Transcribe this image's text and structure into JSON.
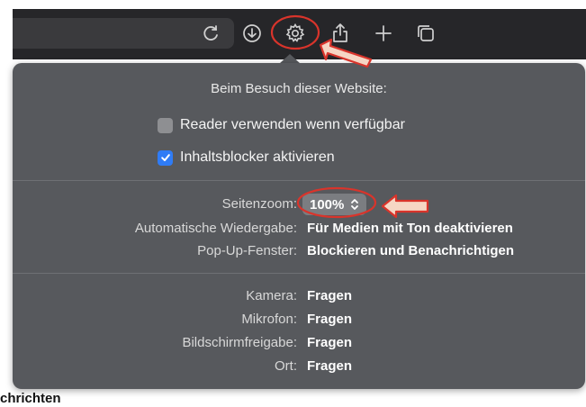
{
  "popover": {
    "title": "Beim Besuch dieser Website:",
    "checkboxes": [
      {
        "label": "Reader verwenden wenn verfügbar",
        "checked": false
      },
      {
        "label": "Inhaltsblocker aktivieren",
        "checked": true
      }
    ],
    "settings": [
      {
        "label": "Seitenzoom:",
        "value": "100%"
      },
      {
        "label": "Automatische Wiedergabe:",
        "value": "Für Medien mit Ton deaktivieren"
      },
      {
        "label": "Pop-Up-Fenster:",
        "value": "Blockieren und Benachrichtigen"
      }
    ],
    "permissions": [
      {
        "label": "Kamera:",
        "value": "Fragen"
      },
      {
        "label": "Mikrofon:",
        "value": "Fragen"
      },
      {
        "label": "Bildschirmfreigabe:",
        "value": "Fragen"
      },
      {
        "label": "Ort:",
        "value": "Fragen"
      }
    ]
  },
  "toolbar": {
    "icons": [
      "reload-icon",
      "download-icon",
      "gear-icon",
      "share-icon",
      "plus-icon",
      "tabs-overview-icon"
    ]
  },
  "page_background": {
    "partial_heading": "chrichten"
  },
  "colors": {
    "toolbar_bg": "#262629",
    "popover_bg": "#57595d",
    "checkbox_accent": "#2f7cf6",
    "annotation_red": "#d9342b",
    "annotation_arrow_fill": "#f6d6c4"
  }
}
